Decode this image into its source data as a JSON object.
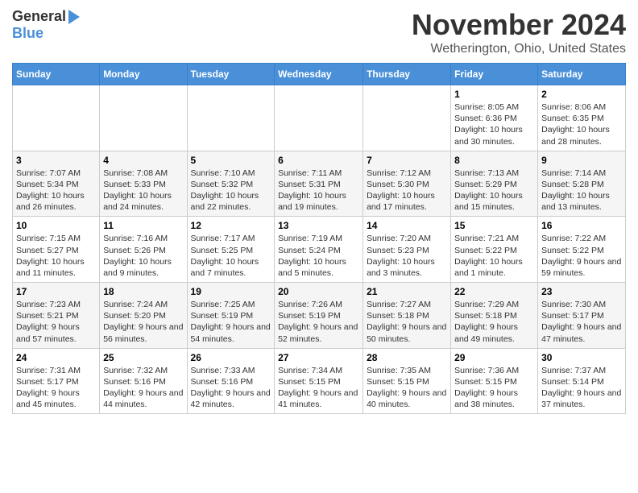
{
  "header": {
    "logo_general": "General",
    "logo_blue": "Blue",
    "title": "November 2024",
    "location": "Wetherington, Ohio, United States"
  },
  "days_of_week": [
    "Sunday",
    "Monday",
    "Tuesday",
    "Wednesday",
    "Thursday",
    "Friday",
    "Saturday"
  ],
  "weeks": [
    [
      {
        "day": "",
        "info": ""
      },
      {
        "day": "",
        "info": ""
      },
      {
        "day": "",
        "info": ""
      },
      {
        "day": "",
        "info": ""
      },
      {
        "day": "",
        "info": ""
      },
      {
        "day": "1",
        "info": "Sunrise: 8:05 AM\nSunset: 6:36 PM\nDaylight: 10 hours and 30 minutes."
      },
      {
        "day": "2",
        "info": "Sunrise: 8:06 AM\nSunset: 6:35 PM\nDaylight: 10 hours and 28 minutes."
      }
    ],
    [
      {
        "day": "3",
        "info": "Sunrise: 7:07 AM\nSunset: 5:34 PM\nDaylight: 10 hours and 26 minutes."
      },
      {
        "day": "4",
        "info": "Sunrise: 7:08 AM\nSunset: 5:33 PM\nDaylight: 10 hours and 24 minutes."
      },
      {
        "day": "5",
        "info": "Sunrise: 7:10 AM\nSunset: 5:32 PM\nDaylight: 10 hours and 22 minutes."
      },
      {
        "day": "6",
        "info": "Sunrise: 7:11 AM\nSunset: 5:31 PM\nDaylight: 10 hours and 19 minutes."
      },
      {
        "day": "7",
        "info": "Sunrise: 7:12 AM\nSunset: 5:30 PM\nDaylight: 10 hours and 17 minutes."
      },
      {
        "day": "8",
        "info": "Sunrise: 7:13 AM\nSunset: 5:29 PM\nDaylight: 10 hours and 15 minutes."
      },
      {
        "day": "9",
        "info": "Sunrise: 7:14 AM\nSunset: 5:28 PM\nDaylight: 10 hours and 13 minutes."
      }
    ],
    [
      {
        "day": "10",
        "info": "Sunrise: 7:15 AM\nSunset: 5:27 PM\nDaylight: 10 hours and 11 minutes."
      },
      {
        "day": "11",
        "info": "Sunrise: 7:16 AM\nSunset: 5:26 PM\nDaylight: 10 hours and 9 minutes."
      },
      {
        "day": "12",
        "info": "Sunrise: 7:17 AM\nSunset: 5:25 PM\nDaylight: 10 hours and 7 minutes."
      },
      {
        "day": "13",
        "info": "Sunrise: 7:19 AM\nSunset: 5:24 PM\nDaylight: 10 hours and 5 minutes."
      },
      {
        "day": "14",
        "info": "Sunrise: 7:20 AM\nSunset: 5:23 PM\nDaylight: 10 hours and 3 minutes."
      },
      {
        "day": "15",
        "info": "Sunrise: 7:21 AM\nSunset: 5:22 PM\nDaylight: 10 hours and 1 minute."
      },
      {
        "day": "16",
        "info": "Sunrise: 7:22 AM\nSunset: 5:22 PM\nDaylight: 9 hours and 59 minutes."
      }
    ],
    [
      {
        "day": "17",
        "info": "Sunrise: 7:23 AM\nSunset: 5:21 PM\nDaylight: 9 hours and 57 minutes."
      },
      {
        "day": "18",
        "info": "Sunrise: 7:24 AM\nSunset: 5:20 PM\nDaylight: 9 hours and 56 minutes."
      },
      {
        "day": "19",
        "info": "Sunrise: 7:25 AM\nSunset: 5:19 PM\nDaylight: 9 hours and 54 minutes."
      },
      {
        "day": "20",
        "info": "Sunrise: 7:26 AM\nSunset: 5:19 PM\nDaylight: 9 hours and 52 minutes."
      },
      {
        "day": "21",
        "info": "Sunrise: 7:27 AM\nSunset: 5:18 PM\nDaylight: 9 hours and 50 minutes."
      },
      {
        "day": "22",
        "info": "Sunrise: 7:29 AM\nSunset: 5:18 PM\nDaylight: 9 hours and 49 minutes."
      },
      {
        "day": "23",
        "info": "Sunrise: 7:30 AM\nSunset: 5:17 PM\nDaylight: 9 hours and 47 minutes."
      }
    ],
    [
      {
        "day": "24",
        "info": "Sunrise: 7:31 AM\nSunset: 5:17 PM\nDaylight: 9 hours and 45 minutes."
      },
      {
        "day": "25",
        "info": "Sunrise: 7:32 AM\nSunset: 5:16 PM\nDaylight: 9 hours and 44 minutes."
      },
      {
        "day": "26",
        "info": "Sunrise: 7:33 AM\nSunset: 5:16 PM\nDaylight: 9 hours and 42 minutes."
      },
      {
        "day": "27",
        "info": "Sunrise: 7:34 AM\nSunset: 5:15 PM\nDaylight: 9 hours and 41 minutes."
      },
      {
        "day": "28",
        "info": "Sunrise: 7:35 AM\nSunset: 5:15 PM\nDaylight: 9 hours and 40 minutes."
      },
      {
        "day": "29",
        "info": "Sunrise: 7:36 AM\nSunset: 5:15 PM\nDaylight: 9 hours and 38 minutes."
      },
      {
        "day": "30",
        "info": "Sunrise: 7:37 AM\nSunset: 5:14 PM\nDaylight: 9 hours and 37 minutes."
      }
    ]
  ]
}
